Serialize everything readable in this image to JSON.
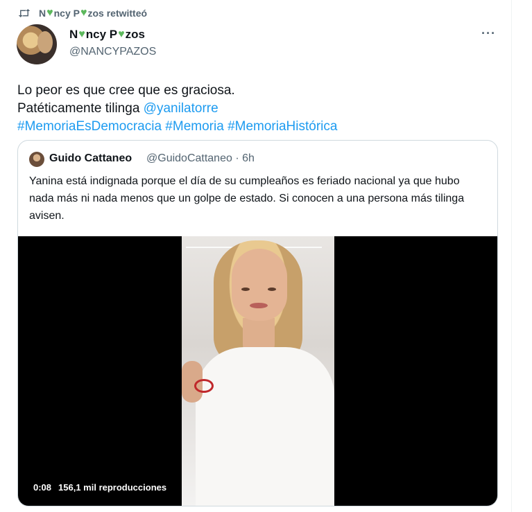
{
  "retweet": {
    "icon": "retweet-icon",
    "text_parts": [
      "N",
      "ncy P",
      "zos retwitteó"
    ]
  },
  "author": {
    "name_parts": [
      "N",
      "ncy P",
      "zos"
    ],
    "handle": "@NANCYPAZOS",
    "emoji": "green-heart-icon",
    "emoji_color": "#5cb85c"
  },
  "more_label": "···",
  "tweet": {
    "line1": "Lo peor es que cree que es graciosa.",
    "line2_text": "Patéticamente tilinga ",
    "mention": "@yanilatorre",
    "hashtags": [
      "#MemoriaEsDemocracia",
      "#Memoria",
      "#MemoriaHistórica"
    ]
  },
  "quote": {
    "name": "Guido Cattaneo",
    "handle_time": "@GuidoCattaneo · 6h",
    "text": "Yanina está indignada porque el día de su cumpleaños es feriado nacional ya que hubo nada más ni nada menos que un golpe de estado. Si conocen a una persona más tilinga avisen.",
    "video": {
      "time": "0:08",
      "views": "156,1 mil reproducciones"
    }
  },
  "colors": {
    "link": "#1d9bf0",
    "secondary_text": "#536471",
    "border": "#cfd9de"
  }
}
